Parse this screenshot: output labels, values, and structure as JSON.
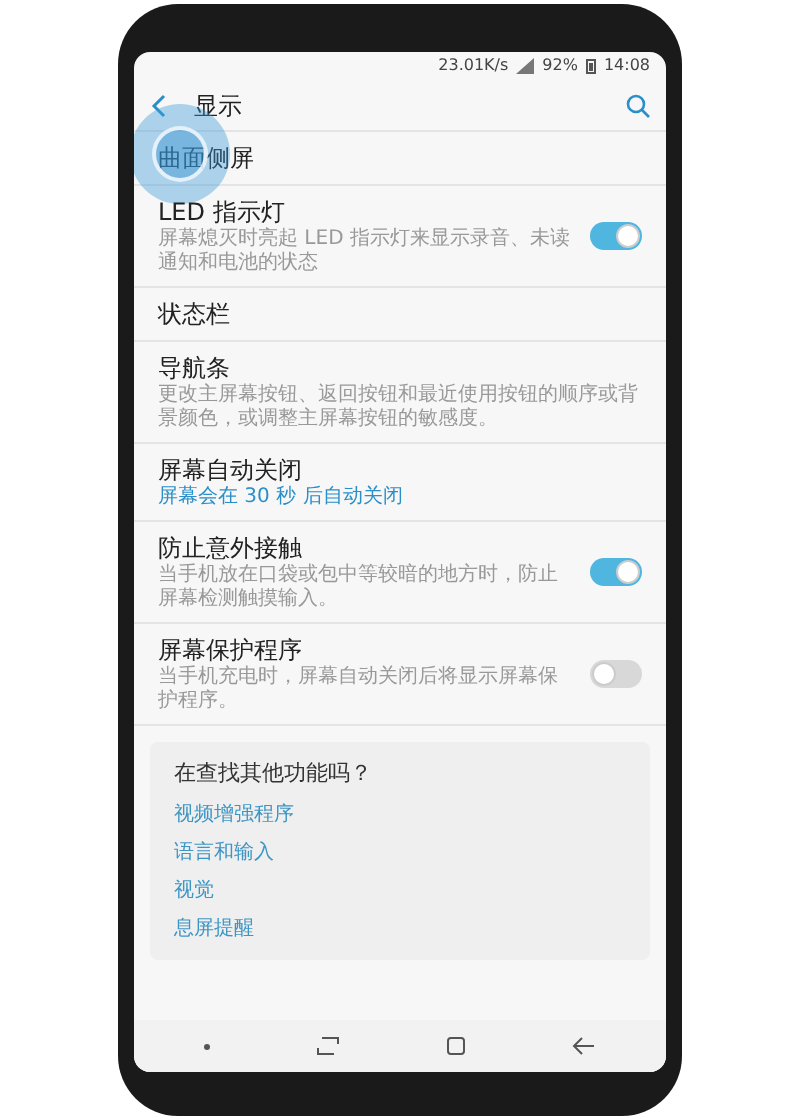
{
  "status_bar": {
    "net_speed": "23.01K/s",
    "battery": "92%",
    "time": "14:08"
  },
  "header": {
    "title": "显示"
  },
  "items": [
    {
      "kind": "plain",
      "title": "曲面侧屏",
      "touched": true
    },
    {
      "kind": "toggle",
      "title": "LED 指示灯",
      "subtitle": "屏幕熄灭时亮起 LED 指示灯来显示录音、未读通知和电池的状态",
      "on": true
    },
    {
      "kind": "plain",
      "title": "状态栏"
    },
    {
      "kind": "plain",
      "title": "导航条",
      "subtitle": "更改主屏幕按钮、返回按钮和最近使用按钮的顺序或背景颜色，或调整主屏幕按钮的敏感度。"
    },
    {
      "kind": "status",
      "title": "屏幕自动关闭",
      "subtitle": "屏幕会在 30 秒 后自动关闭"
    },
    {
      "kind": "toggle",
      "title": "防止意外接触",
      "subtitle": "当手机放在口袋或包中等较暗的地方时，防止屏幕检测触摸输入。",
      "on": true
    },
    {
      "kind": "toggle",
      "title": "屏幕保护程序",
      "subtitle": "当手机充电时，屏幕自动关闭后将显示屏幕保护程序。",
      "on": false
    }
  ],
  "suggestions": {
    "title": "在查找其他功能吗？",
    "links": [
      "视频增强程序",
      "语言和输入",
      "视觉",
      "息屏提醒"
    ]
  }
}
